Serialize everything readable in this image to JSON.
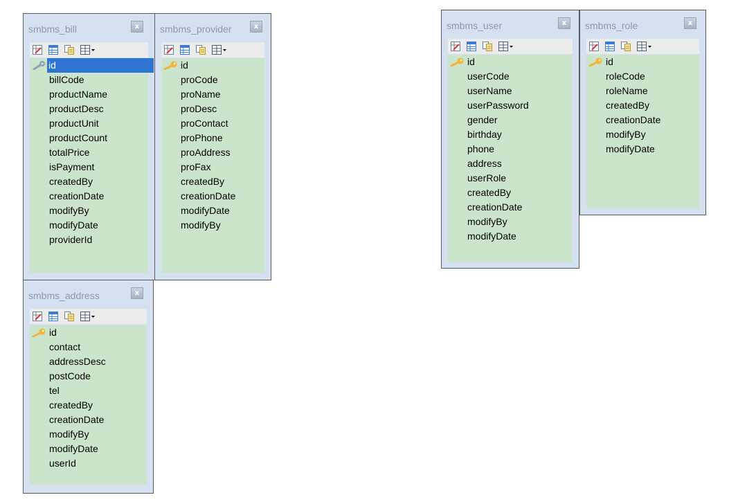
{
  "tables": [
    {
      "id": "bill",
      "title": "smbms_bill",
      "fields": [
        "id",
        "billCode",
        "productName",
        "productDesc",
        "productUnit",
        "productCount",
        "totalPrice",
        "isPayment",
        "createdBy",
        "creationDate",
        "modifyBy",
        "modifyDate",
        "providerId"
      ]
    },
    {
      "id": "provider",
      "title": "smbms_provider",
      "fields": [
        "id",
        "proCode",
        "proName",
        "proDesc",
        "proContact",
        "proPhone",
        "proAddress",
        "proFax",
        "createdBy",
        "creationDate",
        "modifyDate",
        "modifyBy"
      ]
    },
    {
      "id": "address",
      "title": "smbms_address",
      "fields": [
        "id",
        "contact",
        "addressDesc",
        "postCode",
        "tel",
        "createdBy",
        "creationDate",
        "modifyBy",
        "modifyDate",
        "userId"
      ]
    },
    {
      "id": "user",
      "title": "smbms_user",
      "fields": [
        "id",
        "userCode",
        "userName",
        "userPassword",
        "gender",
        "birthday",
        "phone",
        "address",
        "userRole",
        "createdBy",
        "creationDate",
        "modifyBy",
        "modifyDate"
      ]
    },
    {
      "id": "role",
      "title": "smbms_role",
      "fields": [
        "id",
        "roleCode",
        "roleName",
        "createdBy",
        "creationDate",
        "modifyBy",
        "modifyDate"
      ]
    }
  ],
  "close_label": "x",
  "selected_field": {
    "table": "bill",
    "index": 0
  },
  "colors": {
    "panel": "#d5e1f0",
    "fields_bg": "#cbe5cc",
    "selection": "#2f74d0",
    "title": "#8a9ab0"
  },
  "icons": [
    "edit-table-icon",
    "table-design-icon",
    "copy-table-icon",
    "table-grid-menu-icon",
    "primary-key-icon"
  ]
}
